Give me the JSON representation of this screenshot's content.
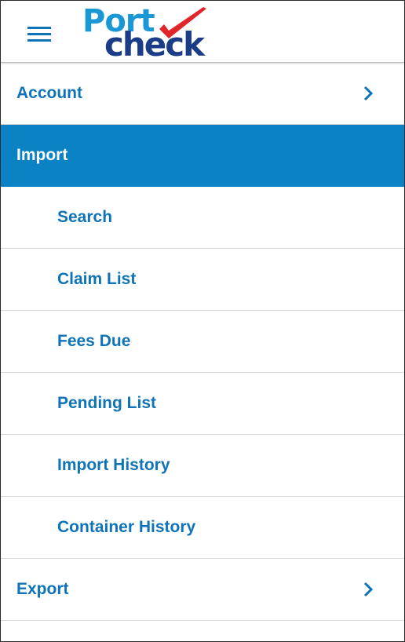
{
  "header": {
    "menu_icon": "hamburger-menu-icon",
    "logo": {
      "line1": "Port",
      "line2": "check",
      "mark": "checkmark-icon"
    }
  },
  "colors": {
    "brand_blue": "#0f73b8",
    "active_bg": "#0a82c4",
    "logo_light": "#1a98d5",
    "logo_dark": "#1b3c87",
    "logo_check": "#e0262b"
  },
  "menu": {
    "account": {
      "label": "Account",
      "icon": "chevron-right-icon"
    },
    "import": {
      "label": "Import",
      "items": [
        "Search",
        "Claim List",
        "Fees Due",
        "Pending List",
        "Import History",
        "Container History"
      ]
    },
    "export": {
      "label": "Export",
      "icon": "chevron-right-icon"
    }
  }
}
